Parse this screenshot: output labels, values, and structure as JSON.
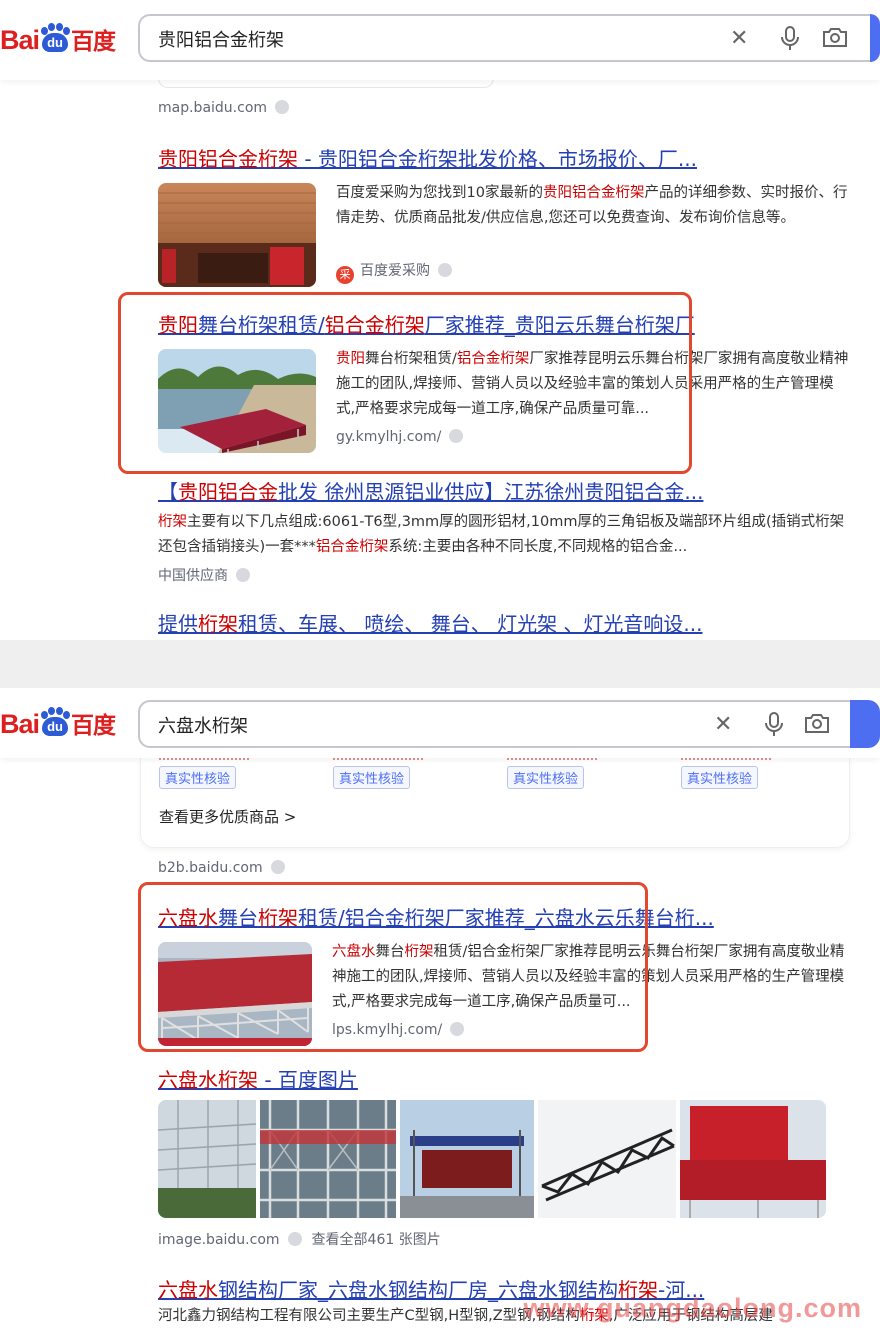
{
  "screens": [
    {
      "logo": {
        "bai": "Bai",
        "du": "du",
        "baidu": "百度"
      },
      "query": "贵阳铝合金桁架",
      "prev_source": "map.baidu.com",
      "results": [
        {
          "title_parts": [
            [
              "贵阳铝合金桁架",
              true
            ],
            [
              " - 贵阳铝合金桁架批发价格、市场报价、厂...",
              false
            ]
          ],
          "snippet_parts": [
            [
              "百度爱采购为您找到10家最新的",
              false
            ],
            [
              "贵阳铝合金桁架",
              true
            ],
            [
              "产品的详细参数、实时报价、行情走势、优质商品批发/供应信息,您还可以免费查询、发布询价信息等。",
              false
            ]
          ],
          "source": "百度爱采购",
          "source_badge": "采"
        },
        {
          "title_parts": [
            [
              "贵阳",
              true
            ],
            [
              "舞台桁架租赁/",
              false
            ],
            [
              "铝合金桁架",
              true
            ],
            [
              "厂家推荐_贵阳云乐舞台桁架厂",
              false
            ]
          ],
          "snippet_parts": [
            [
              "贵阳",
              true
            ],
            [
              "舞台桁架租赁/",
              false
            ],
            [
              "铝合金桁架",
              true
            ],
            [
              "厂家推荐昆明云乐舞台桁架厂家拥有高度敬业精神施工的团队,焊接师、营销人员以及经验丰富的策划人员采用严格的生产管理模式,严格要求完成每一道工序,确保产品质量可靠...",
              false
            ]
          ],
          "source": "gy.kmylhj.com/"
        },
        {
          "title_parts": [
            [
              "【",
              false
            ],
            [
              "贵阳铝合金",
              true
            ],
            [
              "批发 徐州思源铝业供应】江苏徐州贵阳铝合金...",
              false
            ]
          ],
          "snippet_parts": [
            [
              "桁架",
              true
            ],
            [
              "主要有以下几点组成:6061-T6型,3mm厚的圆形铝材,10mm厚的三角铝板及端部环片组成(插销式桁架还包含插销接头)一套***",
              false
            ],
            [
              "铝合金桁架",
              true
            ],
            [
              "系统:主要由各种不同长度,不同规格的铝合金...",
              false
            ]
          ],
          "source": "中国供应商"
        },
        {
          "title_parts": [
            [
              "提供",
              false
            ],
            [
              "桁架",
              true
            ],
            [
              "租赁、车展、 喷绘、 舞台、 灯光架 、灯光音响设...",
              false
            ]
          ]
        }
      ]
    },
    {
      "logo": {
        "bai": "Bai",
        "du": "du",
        "baidu": "百度"
      },
      "query": "六盘水桁架",
      "verify_tags": [
        "真实性核验",
        "真实性核验",
        "真实性核验",
        "真实性核验"
      ],
      "more_goods": "查看更多优质商品 >",
      "prev_source": "b2b.baidu.com",
      "results": [
        {
          "title_parts": [
            [
              "六盘水",
              true
            ],
            [
              "舞台",
              false
            ],
            [
              "桁架",
              true
            ],
            [
              "租赁/铝合金桁架厂家推荐_六盘水云乐舞台桁...",
              false
            ]
          ],
          "snippet_parts": [
            [
              "六盘水",
              true
            ],
            [
              "舞台",
              false
            ],
            [
              "桁架",
              true
            ],
            [
              "租赁/铝合金桁架厂家推荐昆明云乐舞台桁架厂家拥有高度敬业精神施工的团队,焊接师、营销人员以及经验丰富的策划人员采用严格的生产管理模式,严格要求完成每一道工序,确保产品质量可...",
              false
            ]
          ],
          "source": "lps.kmylhj.com/"
        },
        {
          "title_parts": [
            [
              "六盘水桁架",
              true
            ],
            [
              " - 百度图片",
              false
            ]
          ],
          "source": "image.baidu.com",
          "source_extra": "查看全部461 张图片"
        },
        {
          "title_parts": [
            [
              "六盘水",
              true
            ],
            [
              "钢结构厂家_六盘水钢结构厂房_六盘水钢结构",
              false
            ],
            [
              "桁架",
              true
            ],
            [
              "-河...",
              false
            ]
          ],
          "snippet_parts": [
            [
              "河北鑫力钢结构工程有限公司主要生产C型钢,H型钢,Z型钢,钢结构",
              false
            ],
            [
              "桁架",
              true
            ],
            [
              ",广泛应用于钢结构高层建",
              false
            ]
          ]
        }
      ]
    }
  ],
  "watermark": "www.guangdaolong.com",
  "colors": {
    "link": "#2440b3",
    "keyword": "#cc0000",
    "brand_red": "#de1f1f",
    "brand_blue": "#4e6ef2",
    "highlight_box": "#e2472f"
  }
}
